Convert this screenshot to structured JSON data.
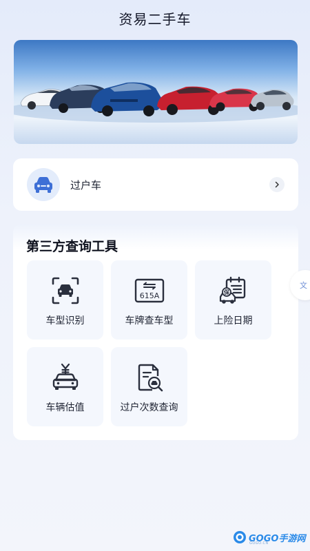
{
  "header": {
    "title": "资易二手车"
  },
  "banner": {
    "alt": "car lineup banner"
  },
  "transfer": {
    "label": "过户车",
    "icon": "car-front-icon"
  },
  "tools": {
    "title": "第三方查询工具",
    "items": [
      {
        "label": "车型识别",
        "icon": "car-scan-icon"
      },
      {
        "label": "车牌查车型",
        "icon": "license-plate-icon",
        "plate_text": "615A"
      },
      {
        "label": "上险日期",
        "icon": "insurance-calendar-icon",
        "badge_text": "保"
      },
      {
        "label": "车辆估值",
        "icon": "car-value-icon"
      },
      {
        "label": "过户次数查询",
        "icon": "transfer-record-icon"
      }
    ]
  },
  "side_float": {
    "label": "文"
  },
  "watermark": {
    "text": "GOGO手游网",
    "sub": "GOGO.CN"
  },
  "colors": {
    "accent": "#3d6fd6",
    "card": "#ffffff",
    "tile": "#f4f7fd",
    "background": "#eef2fb"
  }
}
